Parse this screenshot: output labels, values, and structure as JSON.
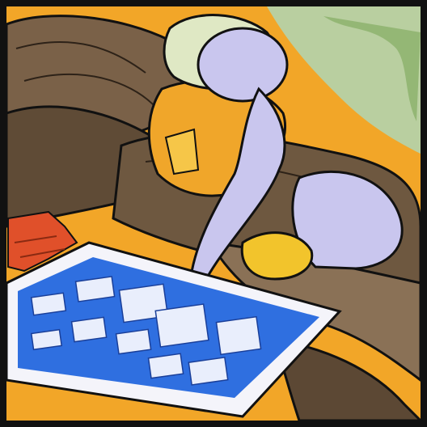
{
  "image": {
    "subject": "illustration-figure-with-blueprint-tablet",
    "palette": {
      "background_orange": "#f2a628",
      "border_black": "#111111",
      "figure_lavender": "#c9c6ee",
      "helmet_pale_green": "#dfe8c4",
      "vest_orange": "#f0a62a",
      "rock_brown": "#6e5840",
      "tablet_blue": "#2f6fe0",
      "tablet_frame": "#f4f4fa",
      "accent_red": "#e0502a",
      "leaf_green": "#8bb06a"
    },
    "icons": [
      "helmet-icon",
      "safety-vest-icon",
      "blueprint-tablet-icon",
      "gloved-hand-icon"
    ]
  }
}
